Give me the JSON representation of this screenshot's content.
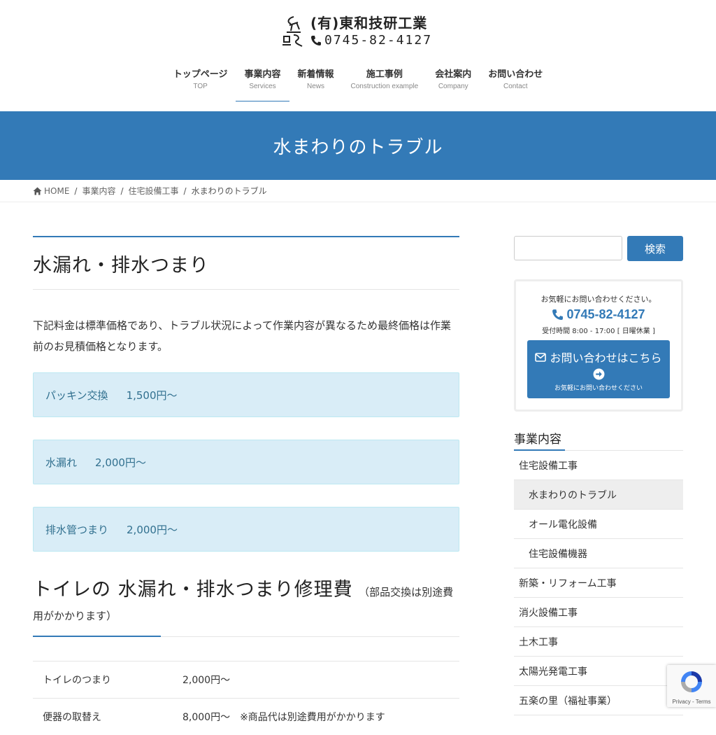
{
  "header": {
    "company": "(有)東和技研工業",
    "phone": "0745-82-4127"
  },
  "nav": [
    {
      "jp": "トップページ",
      "en": "TOP"
    },
    {
      "jp": "事業内容",
      "en": "Services"
    },
    {
      "jp": "新着情報",
      "en": "News"
    },
    {
      "jp": "施工事例",
      "en": "Construction example"
    },
    {
      "jp": "会社案内",
      "en": "Company"
    },
    {
      "jp": "お問い合わせ",
      "en": "Contact"
    }
  ],
  "banner": {
    "title": "水まわりのトラブル"
  },
  "breadcrumb": [
    "HOME",
    "事業内容",
    "住宅設備工事",
    "水まわりのトラブル"
  ],
  "main": {
    "heading": "水漏れ・排水つまり",
    "lead": "下記料金は標準価格であり、トラブル状況によって作業内容が異なるため最終価格は作業前のお見積価格となります。",
    "prices": [
      {
        "name": "パッキン交換",
        "price": "1,500円～"
      },
      {
        "name": "水漏れ",
        "price": "2,000円～"
      },
      {
        "name": "排水管つまり",
        "price": "2,000円～"
      }
    ],
    "heading2_big": "トイレの 水漏れ・排水つまり修理費",
    "heading2_small": "（部品交換は別途費用がかかります）",
    "table": [
      {
        "item": "トイレのつまり",
        "price": "2,000円～"
      },
      {
        "item": "便器の取替え",
        "price": "8,000円～　※商品代は別途費用がかかります"
      }
    ]
  },
  "sidebar": {
    "search_button": "検索",
    "contact_note": "お気軽にお問い合わせください。",
    "contact_phone": "0745-82-4127",
    "contact_hours": "受付時間 8:00 - 17:00 [ 日曜休業 ]",
    "contact_button": "お問い合わせはこちら",
    "contact_button_sub": "お気軽にお問い合わせください",
    "section_title": "事業内容",
    "items": [
      {
        "label": "住宅設備工事"
      },
      {
        "label": "水まわりのトラブル"
      },
      {
        "label": "オール電化設備"
      },
      {
        "label": "住宅設備機器"
      },
      {
        "label": "新築・リフォーム工事"
      },
      {
        "label": "消火設備工事"
      },
      {
        "label": "土木工事"
      },
      {
        "label": "太陽光発電工事"
      },
      {
        "label": "五楽の里（福祉事業）"
      }
    ]
  },
  "recaptcha": {
    "text": "Privacy - Terms"
  },
  "colors": {
    "primary": "#337ab7",
    "alert_bg": "#d9edf7",
    "alert_text": "#31708f"
  }
}
